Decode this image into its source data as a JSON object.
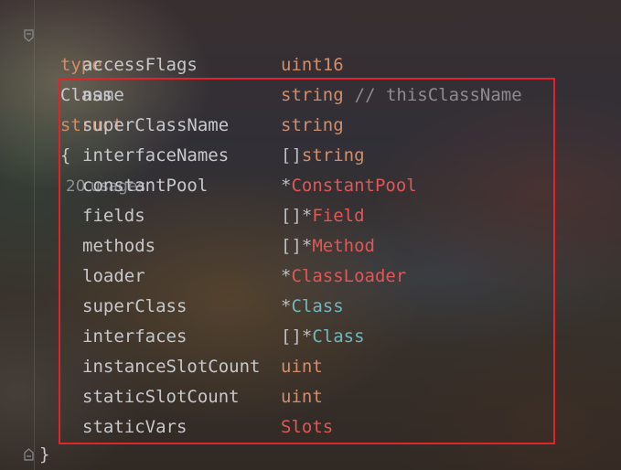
{
  "editor": {
    "decl": {
      "keyword_type": "type",
      "name": "Class",
      "keyword_struct": "struct",
      "brace_open": "{",
      "usages_hint": "20 usages"
    },
    "fields": [
      {
        "name": "accessFlags",
        "prefix": "",
        "type": "uint16",
        "type_kind": "builtin",
        "comment": ""
      },
      {
        "name": "name",
        "prefix": "",
        "type": "string",
        "type_kind": "builtin",
        "comment": "// thisClassName"
      },
      {
        "name": "superClassName",
        "prefix": "",
        "type": "string",
        "type_kind": "builtin",
        "comment": ""
      },
      {
        "name": "interfaceNames",
        "prefix": "[]",
        "type": "string",
        "type_kind": "builtin",
        "comment": ""
      },
      {
        "name": "constantPool",
        "prefix": "*",
        "type": "ConstantPool",
        "type_kind": "struct",
        "comment": ""
      },
      {
        "name": "fields",
        "prefix": "[]*",
        "type": "Field",
        "type_kind": "struct",
        "comment": ""
      },
      {
        "name": "methods",
        "prefix": "[]*",
        "type": "Method",
        "type_kind": "struct",
        "comment": ""
      },
      {
        "name": "loader",
        "prefix": "*",
        "type": "ClassLoader",
        "type_kind": "struct",
        "comment": ""
      },
      {
        "name": "superClass",
        "prefix": "*",
        "type": "Class",
        "type_kind": "class",
        "comment": ""
      },
      {
        "name": "interfaces",
        "prefix": "[]*",
        "type": "Class",
        "type_kind": "class",
        "comment": ""
      },
      {
        "name": "instanceSlotCount",
        "prefix": "",
        "type": "uint",
        "type_kind": "builtin",
        "comment": ""
      },
      {
        "name": "staticSlotCount",
        "prefix": "",
        "type": "uint",
        "type_kind": "builtin",
        "comment": ""
      },
      {
        "name": "staticVars",
        "prefix": "",
        "type": "Slots",
        "type_kind": "slots",
        "comment": ""
      }
    ],
    "brace_close": "}"
  },
  "colors": {
    "keyword": "#cf8e6d",
    "struct_type": "#e05757",
    "class_type": "#6fb8c0",
    "comment": "#8c8c8c",
    "selection_border": "#e0242b"
  }
}
